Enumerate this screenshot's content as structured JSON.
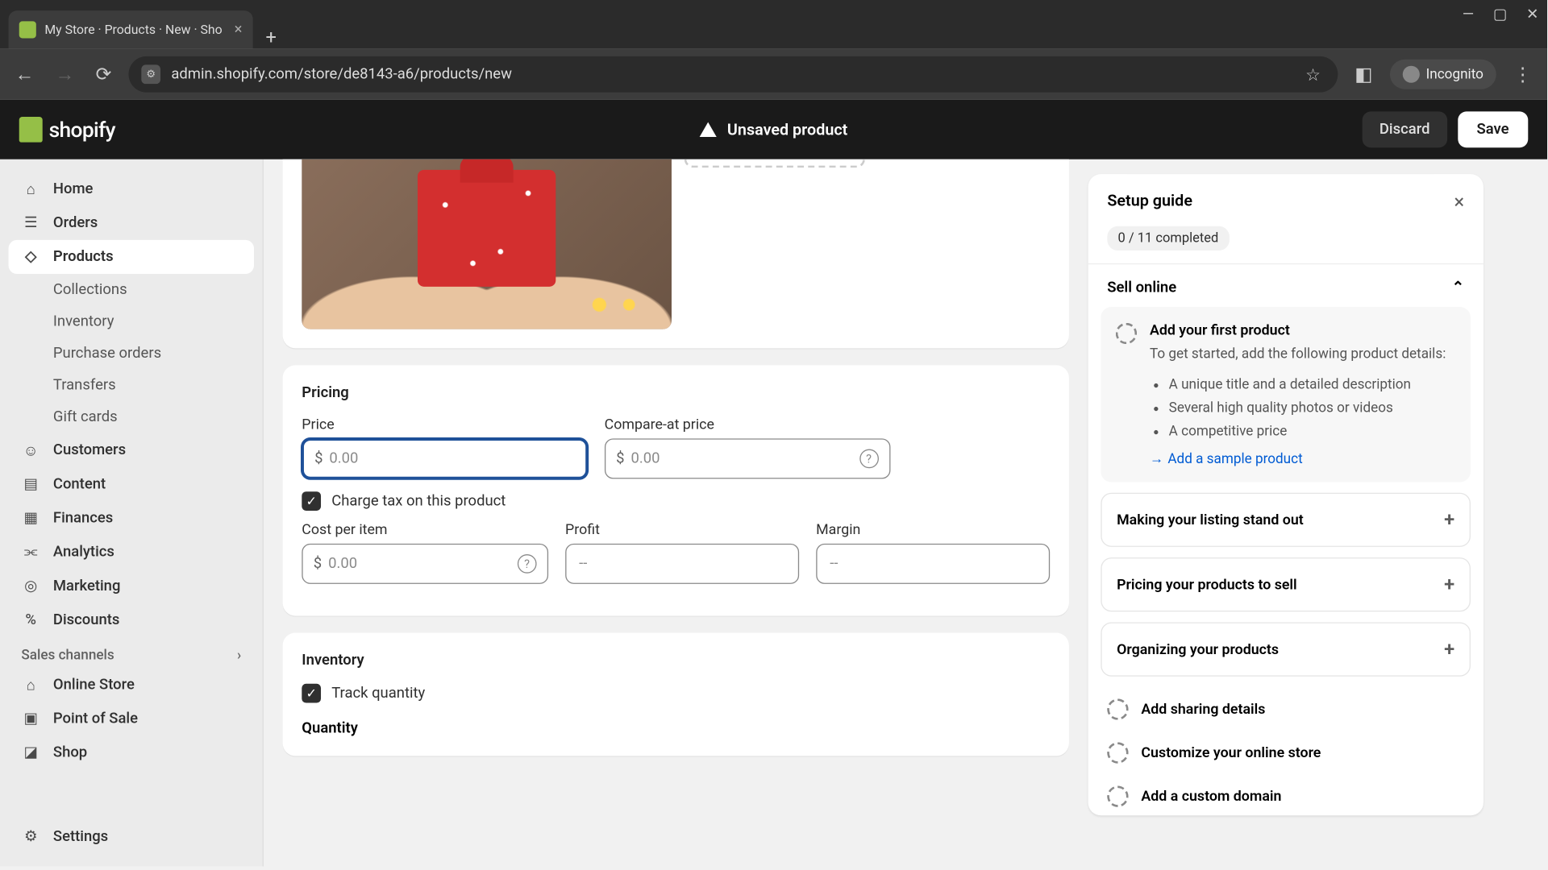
{
  "browser": {
    "tab_title": "My Store · Products · New · Sho",
    "url": "admin.shopify.com/store/de8143-a6/products/new",
    "incognito_label": "Incognito"
  },
  "header": {
    "brand": "shopify",
    "unsaved": "Unsaved product",
    "discard": "Discard",
    "save": "Save"
  },
  "sidebar": {
    "home": "Home",
    "orders": "Orders",
    "products": "Products",
    "collections": "Collections",
    "inventory": "Inventory",
    "purchase_orders": "Purchase orders",
    "transfers": "Transfers",
    "gift_cards": "Gift cards",
    "customers": "Customers",
    "content": "Content",
    "finances": "Finances",
    "analytics": "Analytics",
    "marketing": "Marketing",
    "discounts": "Discounts",
    "sales_channels": "Sales channels",
    "online_store": "Online Store",
    "pos": "Point of Sale",
    "shop": "Shop",
    "settings": "Settings"
  },
  "pricing": {
    "title": "Pricing",
    "price_label": "Price",
    "price_prefix": "$",
    "price_placeholder": "0.00",
    "compare_label": "Compare-at price",
    "compare_prefix": "$",
    "compare_placeholder": "0.00",
    "tax_label": "Charge tax on this product",
    "cost_label": "Cost per item",
    "cost_prefix": "$",
    "cost_placeholder": "0.00",
    "profit_label": "Profit",
    "profit_placeholder": "--",
    "margin_label": "Margin",
    "margin_placeholder": "--"
  },
  "inventory": {
    "title": "Inventory",
    "track": "Track quantity",
    "quantity": "Quantity"
  },
  "setup": {
    "title": "Setup guide",
    "progress": "0 / 11 completed",
    "sell_online": "Sell online",
    "task1_title": "Add your first product",
    "task1_desc": "To get started, add the following product details:",
    "task1_b1": "A unique title and a detailed description",
    "task1_b2": "Several high quality photos or videos",
    "task1_b3": "A competitive price",
    "task1_link": "Add a sample product",
    "task2": "Making your listing stand out",
    "task3": "Pricing your products to sell",
    "task4": "Organizing your products",
    "task5": "Add sharing details",
    "task6": "Customize your online store",
    "task7": "Add a custom domain"
  }
}
